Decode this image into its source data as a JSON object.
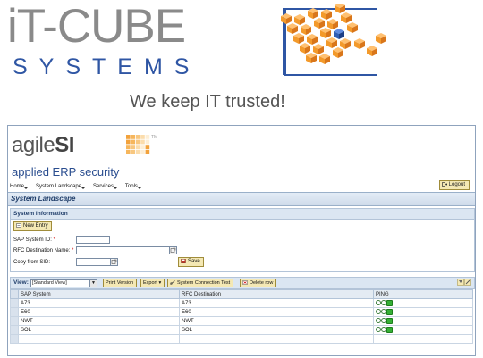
{
  "branding": {
    "company_line1": "iT-CUBE",
    "company_line2": "SYSTEMS",
    "slogan": "We keep IT trusted!",
    "accent": "#2f56a4",
    "cube_color": "#f39a2b",
    "cube_highlight": "#2f5fb5"
  },
  "app": {
    "logo_text_light": "agile",
    "logo_text_bold": "SI",
    "logo_tm": "TM",
    "tagline": "applied ERP security",
    "menu": [
      "Home",
      "System Landscape",
      "Services",
      "Tools"
    ],
    "logout_label": "Logout",
    "page_title": "System Landscape"
  },
  "system_info": {
    "section_title": "System Information",
    "new_entry_label": "New Entry",
    "sap_system_id_label": "SAP System ID:",
    "rfc_destination_label": "RFC Destination Name:",
    "copy_from_sid_label": "Copy from SID:",
    "required_mark": "*",
    "save_label": "Save",
    "sap_system_id_value": "",
    "rfc_destination_value": "",
    "copy_from_sid_value": ""
  },
  "table": {
    "view_label": "View:",
    "view_selected": "[Standard View]",
    "print_label": "Print Version",
    "export_label": "Export",
    "connection_test_label": "System Connection Test",
    "delete_row_label": "Delete row",
    "columns": [
      "SAP System",
      "RFC Destination",
      "PING"
    ],
    "rows": [
      {
        "system": "A73",
        "rfc": "A73"
      },
      {
        "system": "E60",
        "rfc": "E60"
      },
      {
        "system": "NWT",
        "rfc": "NWT"
      },
      {
        "system": "SOL",
        "rfc": "SOL"
      }
    ]
  }
}
